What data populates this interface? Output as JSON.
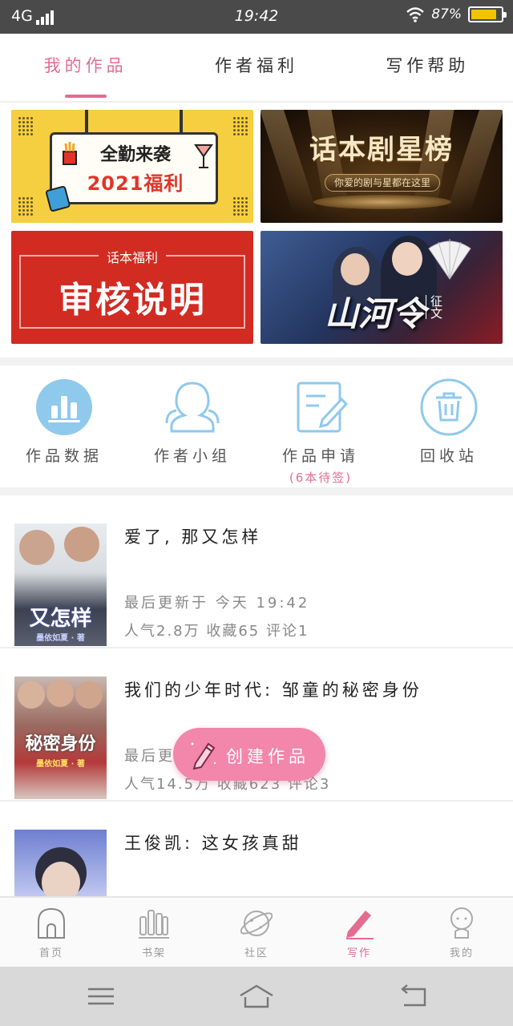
{
  "status_bar": {
    "network": "4G",
    "time": "19:42",
    "battery_text": "87%",
    "battery_level": 0.87
  },
  "tabs": [
    {
      "label": "我的作品",
      "active": true
    },
    {
      "label": "作者福利",
      "active": false
    },
    {
      "label": "写作帮助",
      "active": false
    }
  ],
  "banners": [
    {
      "line1": "全勤来袭",
      "line2": "2021福利"
    },
    {
      "title": "话本剧星榜",
      "subtitle": "你爱的剧与星都在这里"
    },
    {
      "subtitle": "话本福利",
      "title": "审核说明"
    },
    {
      "title": "山河令",
      "tag": "征文"
    }
  ],
  "shortcuts": [
    {
      "label": "作品数据",
      "icon": "bar-chart-icon"
    },
    {
      "label": "作者小组",
      "icon": "group-icon"
    },
    {
      "label": "作品申请",
      "sub": "(6本待签)",
      "icon": "edit-note-icon"
    },
    {
      "label": "回收站",
      "icon": "trash-icon"
    }
  ],
  "works": [
    {
      "title": "爱了, 那又怎样",
      "updated": "最后更新于 今天 19:42",
      "stats": "人气2.8万 收藏65 评论1",
      "cover_text": "又怎样",
      "cover_sub": "墨依如夏 · 著"
    },
    {
      "title": "我们的少年时代: 邹童的秘密身份",
      "updated": "最后更新于",
      "stats": "人气14.5万 收藏623 评论3",
      "cover_text": "秘密身份",
      "cover_sub": "墨依如夏 · 著"
    },
    {
      "title": "王俊凯: 这女孩真甜",
      "updated": "",
      "stats": ""
    }
  ],
  "fab": {
    "label": "创建作品"
  },
  "bottom_nav": [
    {
      "label": "首页",
      "icon": "home-icon"
    },
    {
      "label": "书架",
      "icon": "bookshelf-icon"
    },
    {
      "label": "社区",
      "icon": "planet-icon"
    },
    {
      "label": "写作",
      "icon": "pen-icon",
      "active": true
    },
    {
      "label": "我的",
      "icon": "profile-icon"
    }
  ],
  "colors": {
    "accent": "#e26d90",
    "fab": "#f286ab",
    "icon_blue": "#8fc9ec",
    "status_bar": "#4a4a4a"
  }
}
